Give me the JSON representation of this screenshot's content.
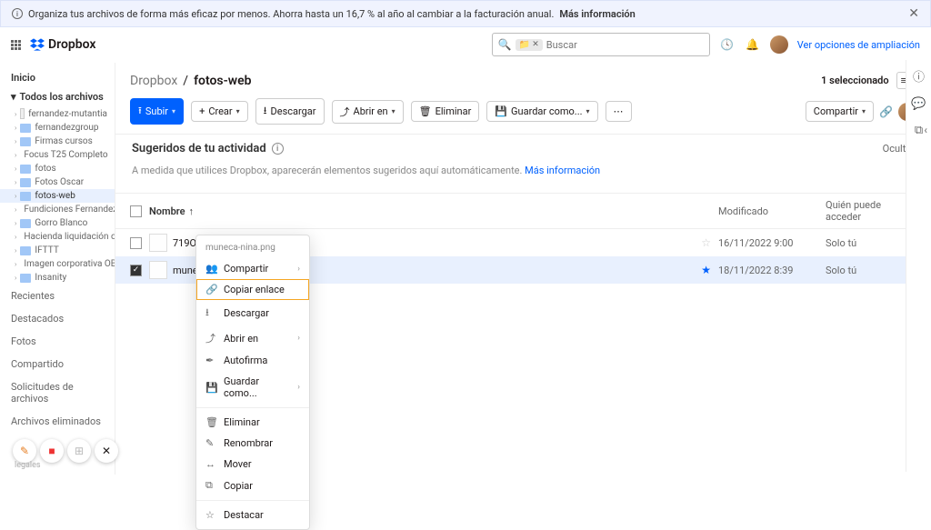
{
  "banner": {
    "text": "Organiza tus archivos de forma más eficaz por menos. Ahorra hasta un 16,7 % al año al cambiar a la facturación anual.",
    "more": "Más información"
  },
  "brand": "Dropbox",
  "search": {
    "placeholder": "Buscar"
  },
  "topLink": "Ver opciones de ampliación",
  "sidebar": {
    "home": "Inicio",
    "section": "Todos los archivos",
    "items": [
      {
        "label": "fernandez-mutantia",
        "type": "person"
      },
      {
        "label": "fernandezgroup",
        "type": "folder"
      },
      {
        "label": "Firmas cursos",
        "type": "folder"
      },
      {
        "label": "Focus T25 Completo",
        "type": "folder"
      },
      {
        "label": "fotos",
        "type": "folder"
      },
      {
        "label": "Fotos Oscar",
        "type": "folder"
      },
      {
        "label": "fotos-web",
        "type": "folder",
        "active": true
      },
      {
        "label": "Fundiciones Fernandez",
        "type": "folder"
      },
      {
        "label": "Gorro Blanco",
        "type": "folder"
      },
      {
        "label": "Hacienda liquidación oscar...",
        "type": "folder"
      },
      {
        "label": "IFTTT",
        "type": "folder"
      },
      {
        "label": "Imagen corporativa OB",
        "type": "folder"
      },
      {
        "label": "Insanity",
        "type": "folder"
      }
    ],
    "links": [
      "Recientes",
      "Destacados",
      "Fotos",
      "Compartido",
      "Solicitudes de archivos",
      "Archivos eliminados"
    ]
  },
  "breadcrumb": {
    "root": "Dropbox",
    "sep": "/",
    "current": "fotos-web"
  },
  "selection": {
    "label": "1 seleccionado"
  },
  "toolbar": {
    "upload": "Subir",
    "create": "Crear",
    "download": "Descargar",
    "open": "Abrir en",
    "delete": "Eliminar",
    "saveas": "Guardar como...",
    "share": "Compartir"
  },
  "suggested": {
    "title": "Sugeridos de tu actividad",
    "hide": "Ocultar",
    "msg": "A medida que utilices Dropbox, aparecerán elementos sugeridos aquí automáticamente.",
    "link": "Más información"
  },
  "table": {
    "cols": {
      "name": "Nombre",
      "modified": "Modificado",
      "access": "Quién puede acceder"
    },
    "rows": [
      {
        "name": "719O5IE17yL._SX425_.jpg",
        "modified": "16/11/2022 9:00",
        "access": "Solo tú",
        "selected": false
      },
      {
        "name": "muneca-nina.png",
        "modified": "18/11/2022 8:39",
        "access": "Solo tú",
        "selected": true
      }
    ]
  },
  "context": {
    "title": "muneca-nina.png",
    "groups": [
      [
        {
          "label": "Compartir",
          "sub": true
        },
        {
          "label": "Copiar enlace",
          "hl": true
        },
        {
          "label": "Descargar"
        },
        {
          "label": "Abrir en",
          "sub": true
        },
        {
          "label": "Autofirma"
        },
        {
          "label": "Guardar como...",
          "sub": true
        }
      ],
      [
        {
          "label": "Eliminar"
        },
        {
          "label": "Renombrar"
        },
        {
          "label": "Mover"
        },
        {
          "label": "Copiar"
        }
      ],
      [
        {
          "label": "Destacar"
        }
      ]
    ],
    "icons": [
      "👥",
      "🔗",
      "⭳",
      "⤴",
      "✒",
      "💾",
      "🗑",
      "✎",
      "↔",
      "⧉",
      "☆"
    ]
  },
  "legal": "legales"
}
